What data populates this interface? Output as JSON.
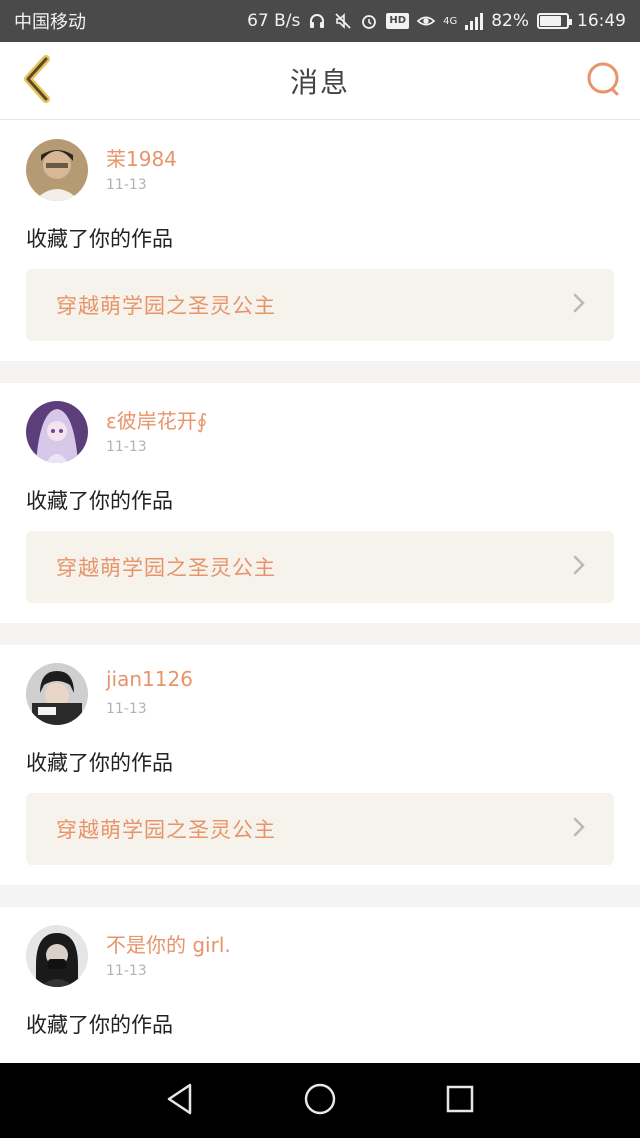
{
  "status_bar": {
    "carrier": "中国移动",
    "net_speed": "67 B/s",
    "battery_pct": "82%",
    "battery_level": 0.82,
    "network_type": "4G",
    "time": "16:49",
    "icons": [
      "headset-icon",
      "mute-icon",
      "alarm-icon",
      "hd-icon",
      "eye-icon",
      "signal-icon",
      "battery-icon"
    ]
  },
  "header": {
    "title": "消息",
    "back_icon": "chevron-left-icon",
    "search_icon": "search-icon",
    "accent_color": "#e8946a"
  },
  "messages": [
    {
      "username": "茉1984",
      "date": "11-13",
      "action": "收藏了你的作品",
      "work_title": "穿越萌学园之圣灵公主"
    },
    {
      "username": "ε彼岸花开∮",
      "date": "11-13",
      "action": "收藏了你的作品",
      "work_title": "穿越萌学园之圣灵公主"
    },
    {
      "username": "jian1126",
      "date": "11-13",
      "action": "收藏了你的作品",
      "work_title": "穿越萌学园之圣灵公主"
    },
    {
      "username": "不是你的 girl.",
      "date": "11-13",
      "action": "收藏了你的作品",
      "work_title": ""
    }
  ],
  "nav_bar": {
    "icons": [
      "back-triangle-icon",
      "home-circle-icon",
      "recents-square-icon"
    ]
  }
}
